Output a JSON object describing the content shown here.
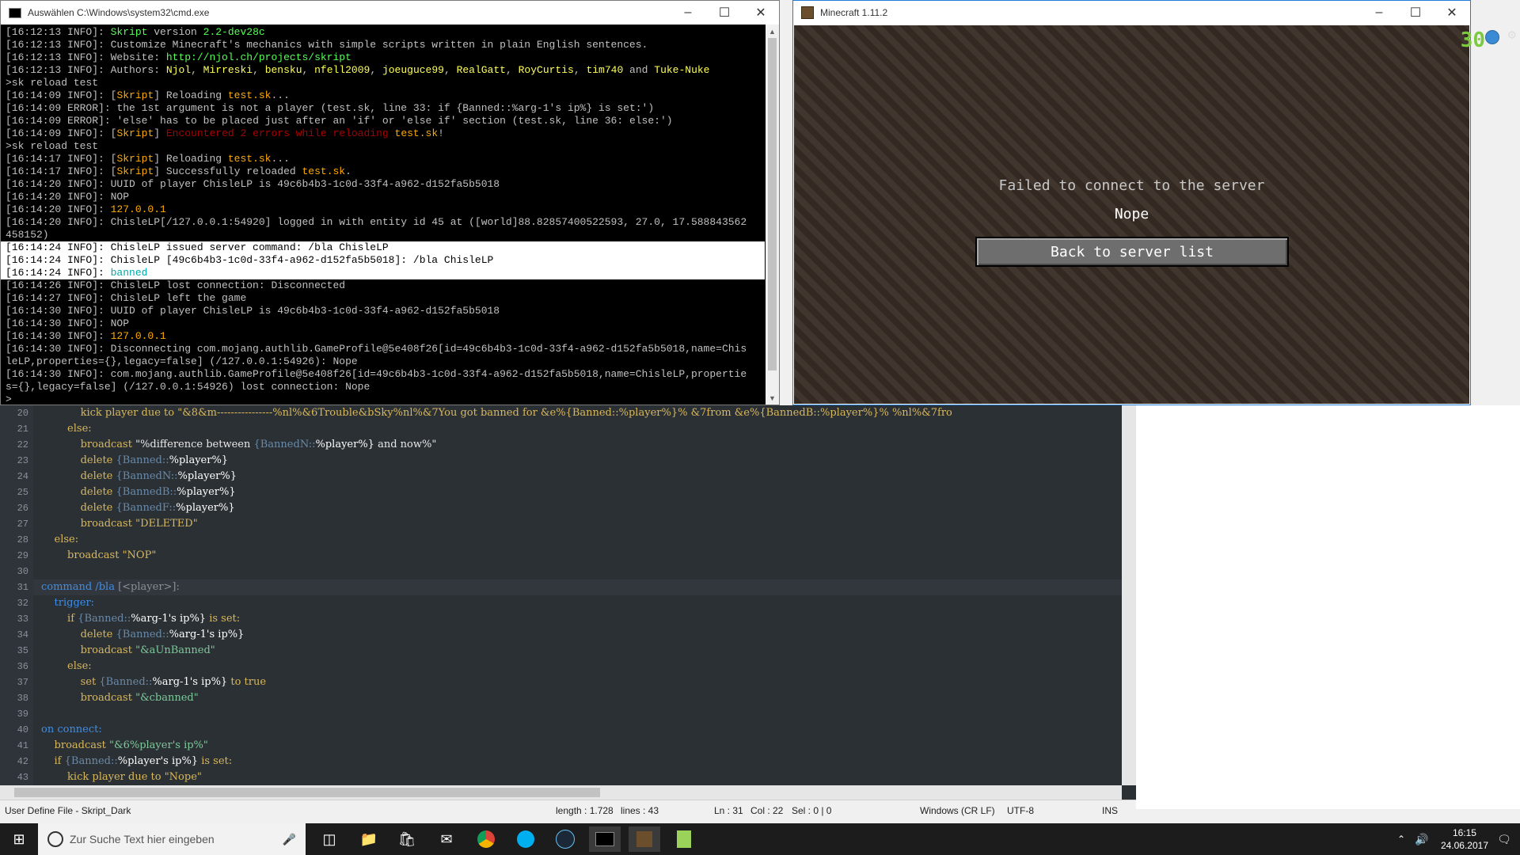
{
  "cmd": {
    "title": "Auswählen C:\\Windows\\system32\\cmd.exe",
    "lines": [
      {
        "p": "[16:12:13 INFO]: ",
        "s": [
          {
            "t": "Skript",
            "c": "#55ff55"
          },
          {
            "t": " version ",
            "c": "#c0c0c0"
          },
          {
            "t": "2.2-dev28c",
            "c": "#55ff55"
          }
        ]
      },
      {
        "p": "[16:12:13 INFO]: ",
        "s": [
          {
            "t": "Customize Minecraft's mechanics with simple scripts written in plain English sentences.",
            "c": "#c0c0c0"
          }
        ]
      },
      {
        "p": "[16:12:13 INFO]: ",
        "s": [
          {
            "t": "Website: ",
            "c": "#c0c0c0"
          },
          {
            "t": "http://njol.ch/projects/skript",
            "c": "#55ff55"
          }
        ]
      },
      {
        "p": "[16:12:13 INFO]: ",
        "s": [
          {
            "t": "Authors: ",
            "c": "#c0c0c0"
          },
          {
            "t": "Njol",
            "c": "#ffff55"
          },
          {
            "t": ", ",
            "c": "#c0c0c0"
          },
          {
            "t": "Mirreski",
            "c": "#ffff55"
          },
          {
            "t": ", ",
            "c": "#c0c0c0"
          },
          {
            "t": "bensku",
            "c": "#ffff55"
          },
          {
            "t": ", ",
            "c": "#c0c0c0"
          },
          {
            "t": "nfell2009",
            "c": "#ffff55"
          },
          {
            "t": ", ",
            "c": "#c0c0c0"
          },
          {
            "t": "joeuguce99",
            "c": "#ffff55"
          },
          {
            "t": ", ",
            "c": "#c0c0c0"
          },
          {
            "t": "RealGatt",
            "c": "#ffff55"
          },
          {
            "t": ", ",
            "c": "#c0c0c0"
          },
          {
            "t": "RoyCurtis",
            "c": "#ffff55"
          },
          {
            "t": ", ",
            "c": "#c0c0c0"
          },
          {
            "t": "tim740",
            "c": "#ffff55"
          },
          {
            "t": " and ",
            "c": "#c0c0c0"
          },
          {
            "t": "Tuke-Nuke",
            "c": "#ffff55"
          }
        ]
      },
      {
        "p": ">sk reload test",
        "s": []
      },
      {
        "p": "[16:14:09 INFO]: ",
        "s": [
          {
            "t": "[",
            "c": "#c0c0c0"
          },
          {
            "t": "Skript",
            "c": "#ffaa00"
          },
          {
            "t": "] Reloading ",
            "c": "#c0c0c0"
          },
          {
            "t": "test.sk",
            "c": "#ffaa00"
          },
          {
            "t": "...",
            "c": "#c0c0c0"
          }
        ]
      },
      {
        "p": "[16:14:09 ERROR]: ",
        "s": [
          {
            "t": "the 1st argument is not a player (test.sk, line 33: if {Banned::%arg-1's ip%} is set:')",
            "c": "#c0c0c0"
          }
        ]
      },
      {
        "p": "[16:14:09 ERROR]: ",
        "s": [
          {
            "t": "'else' has to be placed just after an 'if' or 'else if' section (test.sk, line 36: else:')",
            "c": "#c0c0c0"
          }
        ]
      },
      {
        "p": "[16:14:09 INFO]: ",
        "s": [
          {
            "t": "[",
            "c": "#c0c0c0"
          },
          {
            "t": "Skript",
            "c": "#ffaa00"
          },
          {
            "t": "] ",
            "c": "#c0c0c0"
          },
          {
            "t": "Encountered 2 errors while reloading ",
            "c": "#aa0000"
          },
          {
            "t": "test.sk",
            "c": "#ffaa00"
          },
          {
            "t": "!",
            "c": "#c0c0c0"
          }
        ]
      },
      {
        "p": ">sk reload test",
        "s": []
      },
      {
        "p": "[16:14:17 INFO]: ",
        "s": [
          {
            "t": "[",
            "c": "#c0c0c0"
          },
          {
            "t": "Skript",
            "c": "#ffaa00"
          },
          {
            "t": "] Reloading ",
            "c": "#c0c0c0"
          },
          {
            "t": "test.sk",
            "c": "#ffaa00"
          },
          {
            "t": "...",
            "c": "#c0c0c0"
          }
        ]
      },
      {
        "p": "[16:14:17 INFO]: ",
        "s": [
          {
            "t": "[",
            "c": "#c0c0c0"
          },
          {
            "t": "Skript",
            "c": "#ffaa00"
          },
          {
            "t": "] Successfully reloaded ",
            "c": "#c0c0c0"
          },
          {
            "t": "test.sk",
            "c": "#ffaa00"
          },
          {
            "t": ".",
            "c": "#c0c0c0"
          }
        ]
      },
      {
        "p": "[16:14:20 INFO]: ",
        "s": [
          {
            "t": "UUID of player ChisleLP is 49c6b4b3-1c0d-33f4-a962-d152fa5b5018",
            "c": "#c0c0c0"
          }
        ]
      },
      {
        "p": "[16:14:20 INFO]: ",
        "s": [
          {
            "t": "NOP",
            "c": "#c0c0c0"
          }
        ]
      },
      {
        "p": "[16:14:20 INFO]: ",
        "s": [
          {
            "t": "127.0.0.1",
            "c": "#ffaa00"
          }
        ]
      },
      {
        "p": "[16:14:20 INFO]: ",
        "s": [
          {
            "t": "ChisleLP[/127.0.0.1:54920] logged in with entity id 45 at ([world]88.82857400522593, 27.0, 17.588843562",
            "c": "#c0c0c0"
          }
        ]
      },
      {
        "p": "458152)",
        "s": []
      },
      {
        "p": "[16:14:24 INFO]: ",
        "sel": true,
        "s": [
          {
            "t": "ChisleLP issued server command: /bla ChisleLP",
            "c": "#000"
          }
        ]
      },
      {
        "p": "[16:14:24 INFO]: ",
        "sel": true,
        "s": [
          {
            "t": "ChisleLP [49c6b4b3-1c0d-33f4-a962-d152fa5b5018]: /bla ChisleLP",
            "c": "#000"
          }
        ]
      },
      {
        "p": "[16:14:24 INFO]: ",
        "sel": true,
        "s": [
          {
            "t": "banned",
            "c": "#00aaaa"
          }
        ]
      },
      {
        "p": "[16:14:26 INFO]: ",
        "s": [
          {
            "t": "ChisleLP lost connection: Disconnected",
            "c": "#c0c0c0"
          }
        ]
      },
      {
        "p": "[16:14:27 INFO]: ",
        "s": [
          {
            "t": "ChisleLP left the game",
            "c": "#c0c0c0"
          }
        ]
      },
      {
        "p": "[16:14:30 INFO]: ",
        "s": [
          {
            "t": "UUID of player ChisleLP is 49c6b4b3-1c0d-33f4-a962-d152fa5b5018",
            "c": "#c0c0c0"
          }
        ]
      },
      {
        "p": "[16:14:30 INFO]: ",
        "s": [
          {
            "t": "NOP",
            "c": "#c0c0c0"
          }
        ]
      },
      {
        "p": "[16:14:30 INFO]: ",
        "s": [
          {
            "t": "127.0.0.1",
            "c": "#ffaa00"
          }
        ]
      },
      {
        "p": "[16:14:30 INFO]: ",
        "s": [
          {
            "t": "Disconnecting com.mojang.authlib.GameProfile@5e408f26[id=49c6b4b3-1c0d-33f4-a962-d152fa5b5018,name=Chis",
            "c": "#c0c0c0"
          }
        ]
      },
      {
        "p": "leLP,properties={},legacy=false] (/127.0.0.1:54926): Nope",
        "s": []
      },
      {
        "p": "[16:14:30 INFO]: ",
        "s": [
          {
            "t": "com.mojang.authlib.GameProfile@5e408f26[id=49c6b4b3-1c0d-33f4-a962-d152fa5b5018,name=ChisleLP,propertie",
            "c": "#c0c0c0"
          }
        ]
      },
      {
        "p": "s={},legacy=false] (/127.0.0.1:54926) lost connection: Nope",
        "s": []
      },
      {
        "p": ">",
        "s": []
      }
    ]
  },
  "minecraft": {
    "title": "Minecraft 1.11.2",
    "fps": "30",
    "message": "Failed to connect to the server",
    "reason": "Nope",
    "button": "Back to server list"
  },
  "editor": {
    "lines": [
      {
        "n": "20",
        "segs": [
          {
            "t": "            ",
            "c": ""
          },
          {
            "t": "kick player due to ",
            "c": "#d9b85b"
          },
          {
            "t": "\"&8&m----------------%nl%&6Trouble&bSky%nl%&7You got banned for &e%{Banned::%player%}% &7from &e%{BannedB::%player%}% %nl%&7fro",
            "c": "#d9b85b"
          }
        ]
      },
      {
        "n": "21",
        "segs": [
          {
            "t": "        else:",
            "c": "#d9b85b"
          }
        ]
      },
      {
        "n": "22",
        "segs": [
          {
            "t": "            broadcast ",
            "c": "#d9b85b"
          },
          {
            "t": "\"%difference between ",
            "c": "#e8e8e8"
          },
          {
            "t": "{BannedN::",
            "c": "#6a8aa8"
          },
          {
            "t": "%player%}",
            "c": "#ffffff"
          },
          {
            "t": " and now%\"",
            "c": "#e8e8e8"
          }
        ]
      },
      {
        "n": "23",
        "segs": [
          {
            "t": "            delete ",
            "c": "#d9b85b"
          },
          {
            "t": "{Banned::",
            "c": "#6a8aa8"
          },
          {
            "t": "%player%}",
            "c": "#ffffff"
          }
        ]
      },
      {
        "n": "24",
        "segs": [
          {
            "t": "            delete ",
            "c": "#d9b85b"
          },
          {
            "t": "{BannedN::",
            "c": "#6a8aa8"
          },
          {
            "t": "%player%}",
            "c": "#ffffff"
          }
        ]
      },
      {
        "n": "25",
        "segs": [
          {
            "t": "            delete ",
            "c": "#d9b85b"
          },
          {
            "t": "{BannedB::",
            "c": "#6a8aa8"
          },
          {
            "t": "%player%}",
            "c": "#ffffff"
          }
        ]
      },
      {
        "n": "26",
        "segs": [
          {
            "t": "            delete ",
            "c": "#d9b85b"
          },
          {
            "t": "{BannedF::",
            "c": "#6a8aa8"
          },
          {
            "t": "%player%}",
            "c": "#ffffff"
          }
        ]
      },
      {
        "n": "27",
        "segs": [
          {
            "t": "            broadcast ",
            "c": "#d9b85b"
          },
          {
            "t": "\"DELETED\"",
            "c": "#d9b85b"
          }
        ]
      },
      {
        "n": "28",
        "segs": [
          {
            "t": "    else:",
            "c": "#d9b85b"
          }
        ]
      },
      {
        "n": "29",
        "segs": [
          {
            "t": "        broadcast ",
            "c": "#d9b85b"
          },
          {
            "t": "\"NOP\"",
            "c": "#d9b85b"
          }
        ]
      },
      {
        "n": "30",
        "segs": []
      },
      {
        "n": "31",
        "cur": true,
        "segs": [
          {
            "t": "command ",
            "c": "#3d8ee8"
          },
          {
            "t": "/bla ",
            "c": "#3d8ee8"
          },
          {
            "t": "[<player>]:",
            "c": "#8a8f96"
          }
        ]
      },
      {
        "n": "32",
        "segs": [
          {
            "t": "    trigger:",
            "c": "#3d8ee8"
          }
        ]
      },
      {
        "n": "33",
        "segs": [
          {
            "t": "        if ",
            "c": "#d9b85b"
          },
          {
            "t": "{Banned::",
            "c": "#6a8aa8"
          },
          {
            "t": "%arg-1's ip%}",
            "c": "#ffffff"
          },
          {
            "t": " is set:",
            "c": "#d9b85b"
          }
        ]
      },
      {
        "n": "34",
        "segs": [
          {
            "t": "            delete ",
            "c": "#d9b85b"
          },
          {
            "t": "{Banned::",
            "c": "#6a8aa8"
          },
          {
            "t": "%arg-1's ip%}",
            "c": "#ffffff"
          }
        ]
      },
      {
        "n": "35",
        "segs": [
          {
            "t": "            broadcast ",
            "c": "#d9b85b"
          },
          {
            "t": "\"&aUnBanned\"",
            "c": "#7ec99a"
          }
        ]
      },
      {
        "n": "36",
        "segs": [
          {
            "t": "        else:",
            "c": "#d9b85b"
          }
        ]
      },
      {
        "n": "37",
        "segs": [
          {
            "t": "            set ",
            "c": "#d9b85b"
          },
          {
            "t": "{Banned::",
            "c": "#6a8aa8"
          },
          {
            "t": "%arg-1's ip%}",
            "c": "#ffffff"
          },
          {
            "t": " to true",
            "c": "#d9b85b"
          }
        ]
      },
      {
        "n": "38",
        "segs": [
          {
            "t": "            broadcast ",
            "c": "#d9b85b"
          },
          {
            "t": "\"&cbanned\"",
            "c": "#7ec99a"
          }
        ]
      },
      {
        "n": "39",
        "segs": []
      },
      {
        "n": "40",
        "segs": [
          {
            "t": "on connect:",
            "c": "#3d8ee8"
          }
        ]
      },
      {
        "n": "41",
        "segs": [
          {
            "t": "    broadcast ",
            "c": "#d9b85b"
          },
          {
            "t": "\"&6%player's ip%\"",
            "c": "#7ec99a"
          }
        ]
      },
      {
        "n": "42",
        "segs": [
          {
            "t": "    if ",
            "c": "#d9b85b"
          },
          {
            "t": "{Banned::",
            "c": "#6a8aa8"
          },
          {
            "t": "%player's ip%}",
            "c": "#ffffff"
          },
          {
            "t": " is set:",
            "c": "#d9b85b"
          }
        ]
      },
      {
        "n": "43",
        "segs": [
          {
            "t": "        kick player due to ",
            "c": "#d9b85b"
          },
          {
            "t": "\"Nope\"",
            "c": "#d9b85b"
          }
        ]
      }
    ]
  },
  "status": {
    "filetype": "User Define File - Skript_Dark",
    "length": "length : 1.728",
    "lines": "lines : 43",
    "ln": "Ln : 31",
    "col": "Col : 22",
    "sel": "Sel : 0 | 0",
    "eol": "Windows (CR LF)",
    "enc": "UTF-8",
    "mode": "INS"
  },
  "taskbar": {
    "search_placeholder": "Zur Suche Text hier eingeben",
    "time": "16:15",
    "date": "24.06.2017"
  }
}
